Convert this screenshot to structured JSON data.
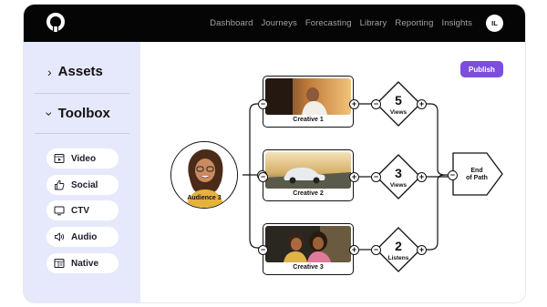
{
  "nav": {
    "items": [
      "Dashboard",
      "Journeys",
      "Forecasting",
      "Library",
      "Reporting",
      "Insights"
    ],
    "user_initials": "IL"
  },
  "sidebar": {
    "assets_label": "Assets",
    "toolbox_label": "Toolbox",
    "tools": [
      {
        "label": "Video",
        "icon": "video-icon"
      },
      {
        "label": "Social",
        "icon": "thumbs-up-icon"
      },
      {
        "label": "CTV",
        "icon": "tv-icon"
      },
      {
        "label": "Audio",
        "icon": "speaker-icon"
      },
      {
        "label": "Native",
        "icon": "layout-icon"
      }
    ]
  },
  "canvas": {
    "publish_label": "Publish",
    "audience": {
      "label": "Audience 3"
    },
    "creatives": [
      {
        "label": "Creative 1"
      },
      {
        "label": "Creative 2"
      },
      {
        "label": "Creative 3"
      }
    ],
    "metrics": [
      {
        "value": "5",
        "unit": "Views"
      },
      {
        "value": "3",
        "unit": "Views"
      },
      {
        "value": "2",
        "unit": "Listens"
      }
    ],
    "end": {
      "line1": "End",
      "line2": "of Path"
    }
  },
  "colors": {
    "topbar": "#050505",
    "sidebar": "#e6e9fb",
    "accent": "#7c4ddf"
  }
}
